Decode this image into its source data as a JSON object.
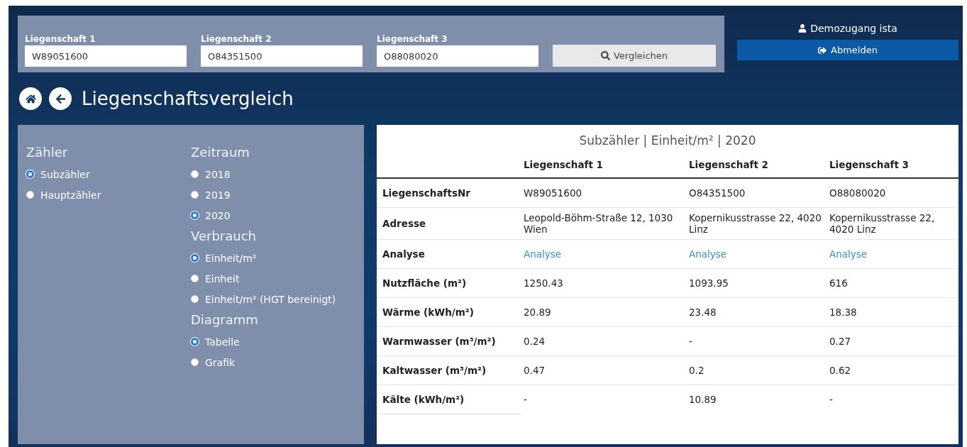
{
  "search_bar": {
    "fields": [
      {
        "label": "Liegenschaft 1",
        "value": "W89051600"
      },
      {
        "label": "Liegenschaft 2",
        "value": "O84351500"
      },
      {
        "label": "Liegenschaft 3",
        "value": "O88080020"
      }
    ],
    "button": "Vergleichen"
  },
  "user": {
    "name": "Demozugang ista",
    "logout": "Abmelden"
  },
  "page_title": "Liegenschaftsvergleich",
  "filter_columns": [
    [
      {
        "title": "Zähler",
        "options": [
          {
            "label": "Subzähler",
            "selected": true
          },
          {
            "label": "Hauptzähler",
            "selected": false
          }
        ]
      }
    ],
    [
      {
        "title": "Zeitraum",
        "options": [
          {
            "label": "2018",
            "selected": false
          },
          {
            "label": "2019",
            "selected": false
          },
          {
            "label": "2020",
            "selected": true
          }
        ]
      },
      {
        "title": "Verbrauch",
        "options": [
          {
            "label": "Einheit/m²",
            "selected": true
          },
          {
            "label": "Einheit",
            "selected": false
          },
          {
            "label": "Einheit/m² (HGT bereinigt)",
            "selected": false
          }
        ]
      },
      {
        "title": "Diagramm",
        "options": [
          {
            "label": "Tabelle",
            "selected": true
          },
          {
            "label": "Grafik",
            "selected": false
          }
        ]
      }
    ]
  ],
  "table": {
    "caption": "Subzähler | Einheit/m² | 2020",
    "columns": [
      "Liegenschaft 1",
      "Liegenschaft 2",
      "Liegenschaft 3"
    ],
    "rows": [
      {
        "label": "LiegenschaftsNr",
        "kind": "text",
        "cells": [
          "W89051600",
          "O84351500",
          "O88080020"
        ]
      },
      {
        "label": "Adresse",
        "kind": "text",
        "cells": [
          "Leopold-Böhm-Straße 12, 1030 Wien",
          "Kopernikusstrasse 22, 4020 Linz",
          "Kopernikusstrasse 22, 4020 Linz"
        ]
      },
      {
        "label": "Analyse",
        "kind": "link",
        "cells": [
          "Analyse",
          "Analyse",
          "Analyse"
        ]
      },
      {
        "label": "Nutzfläche (m²)",
        "kind": "text",
        "cells": [
          "1250.43",
          "1093.95",
          "616"
        ]
      },
      {
        "label": "Wärme (kWh/m²)",
        "kind": "text",
        "cells": [
          "20.89",
          "23.48",
          "18.38"
        ]
      },
      {
        "label": "Warmwasser (m³/m²)",
        "kind": "text",
        "cells": [
          "0.24",
          "-",
          "0.27"
        ]
      },
      {
        "label": "Kaltwasser (m³/m²)",
        "kind": "text",
        "cells": [
          "0.47",
          "0.2",
          "0.62"
        ]
      },
      {
        "label": "Kälte (kWh/m²)",
        "kind": "text",
        "cells": [
          "-",
          "10.89",
          "-"
        ]
      }
    ]
  }
}
